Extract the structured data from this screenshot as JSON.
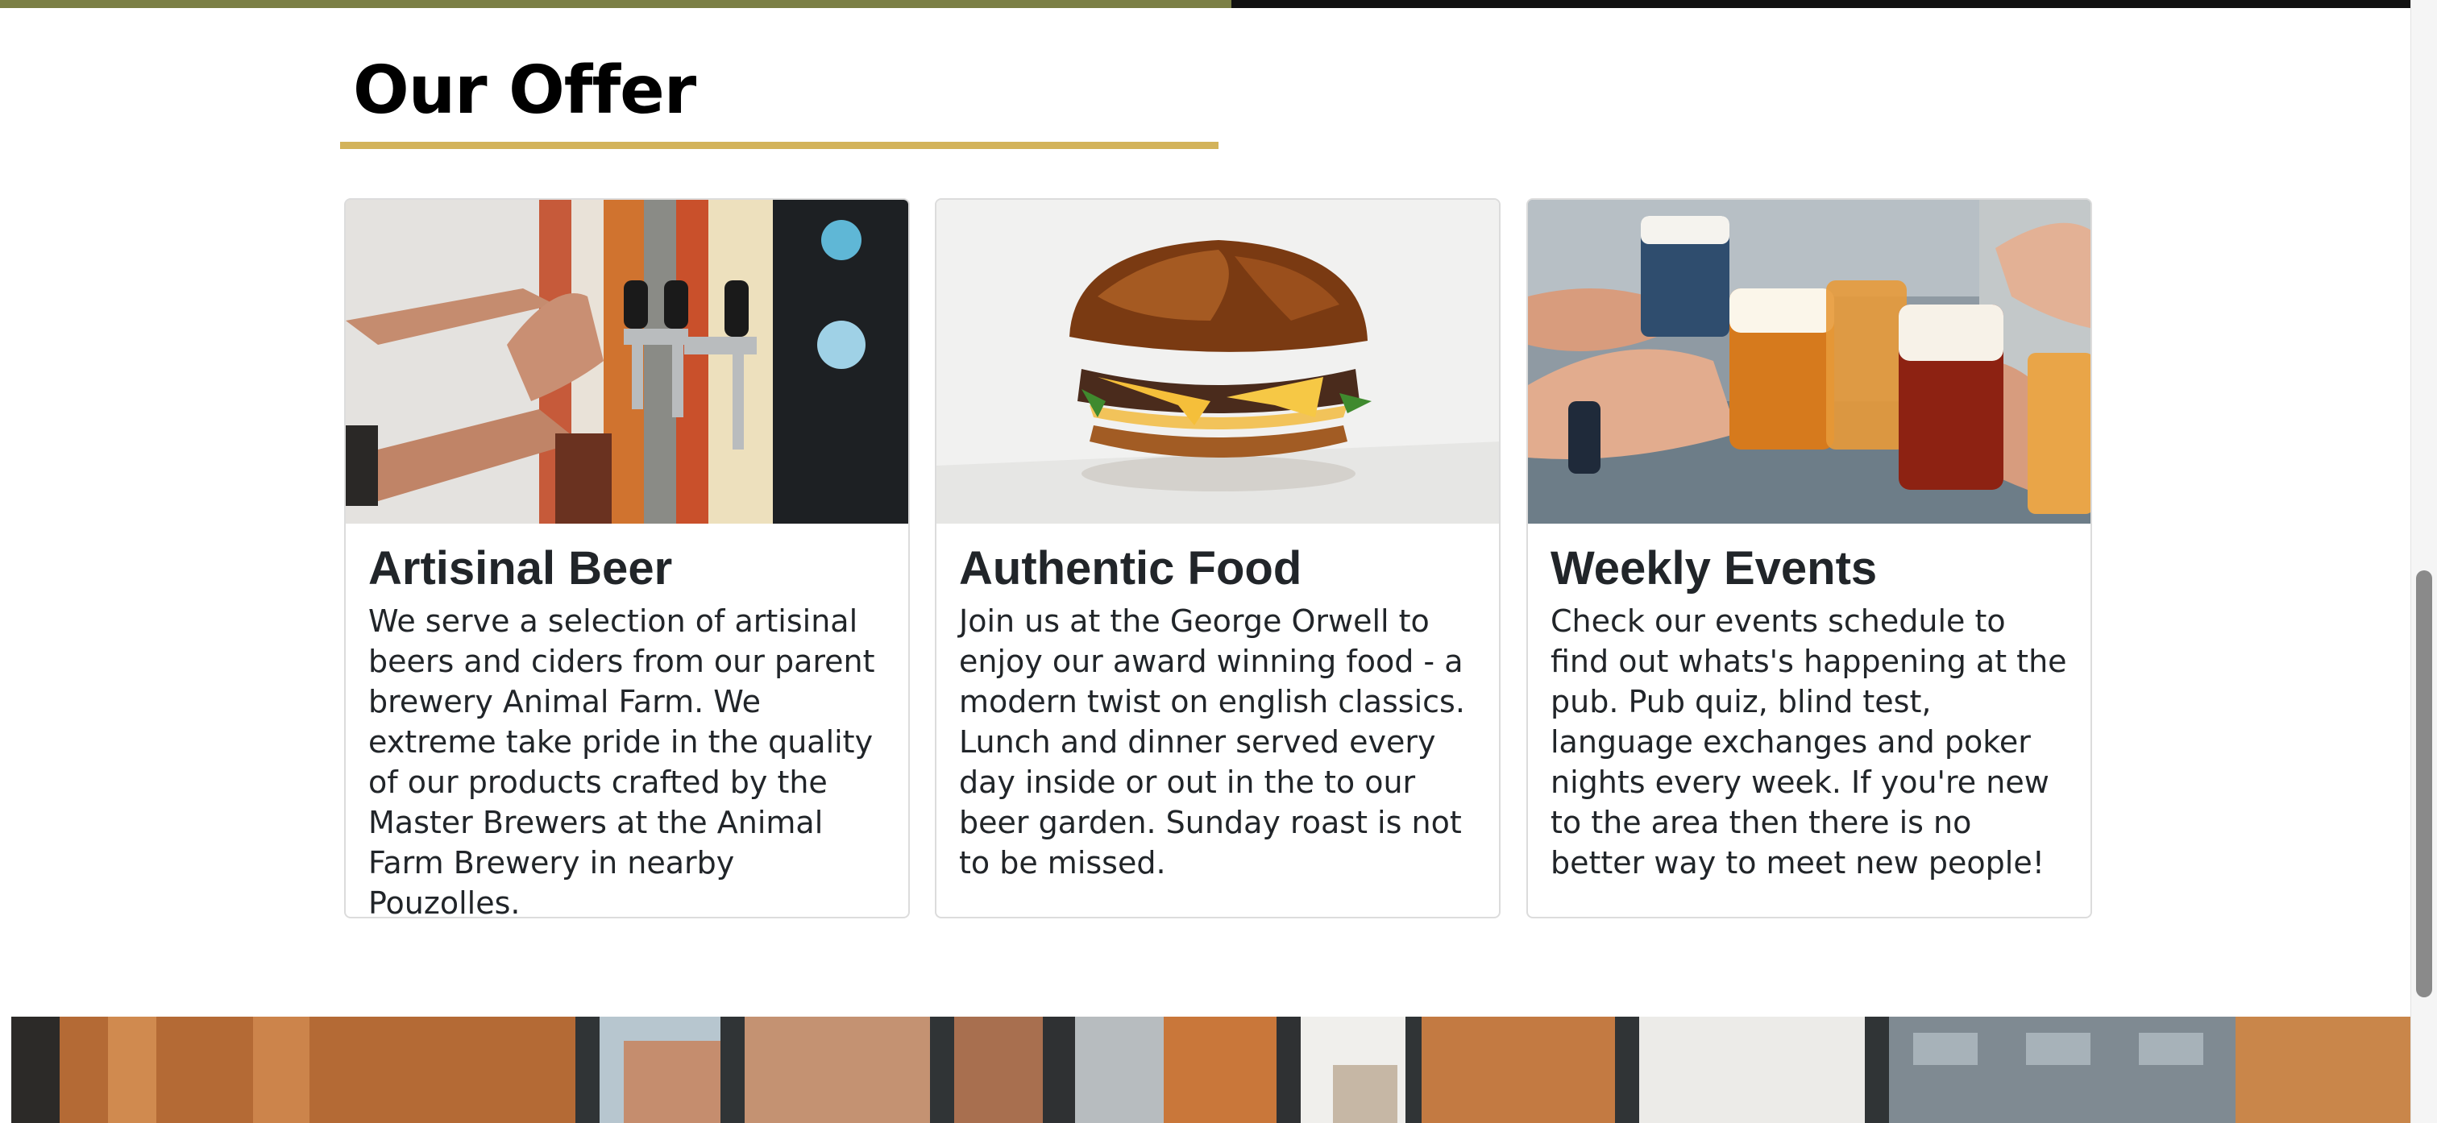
{
  "section": {
    "title": "Our Offer"
  },
  "cards": [
    {
      "title": "Artisinal Beer",
      "text": "We serve a selection of artisinal beers and ciders from our parent brewery Animal Farm. We extreme take pride in the quality of our products crafted by the Master Brewers at the Animal Farm Brewery in nearby Pouzolles.",
      "image": "beer-taps-photo"
    },
    {
      "title": "Authentic Food",
      "text": "Join us at the George Orwell to enjoy our award winning food - a modern twist on english classics. Lunch and dinner served every day inside or out in the to our beer garden. Sunday roast is not to be missed.",
      "image": "burger-photo"
    },
    {
      "title": "Weekly Events",
      "text": "Check our events schedule to find out whats's happening at the pub. Pub quiz, blind test, language exchanges and poker nights every week. If you're new to the area then there is no better way to meet new people!",
      "image": "beer-cheers-photo"
    }
  ],
  "banner": {
    "image": "brewery-tanks-photo"
  },
  "colors": {
    "accent_underline": "#d3b35a",
    "top_bar_olive": "#7b7f45",
    "top_bar_dark": "#111111",
    "card_border": "#dcdcdc"
  }
}
